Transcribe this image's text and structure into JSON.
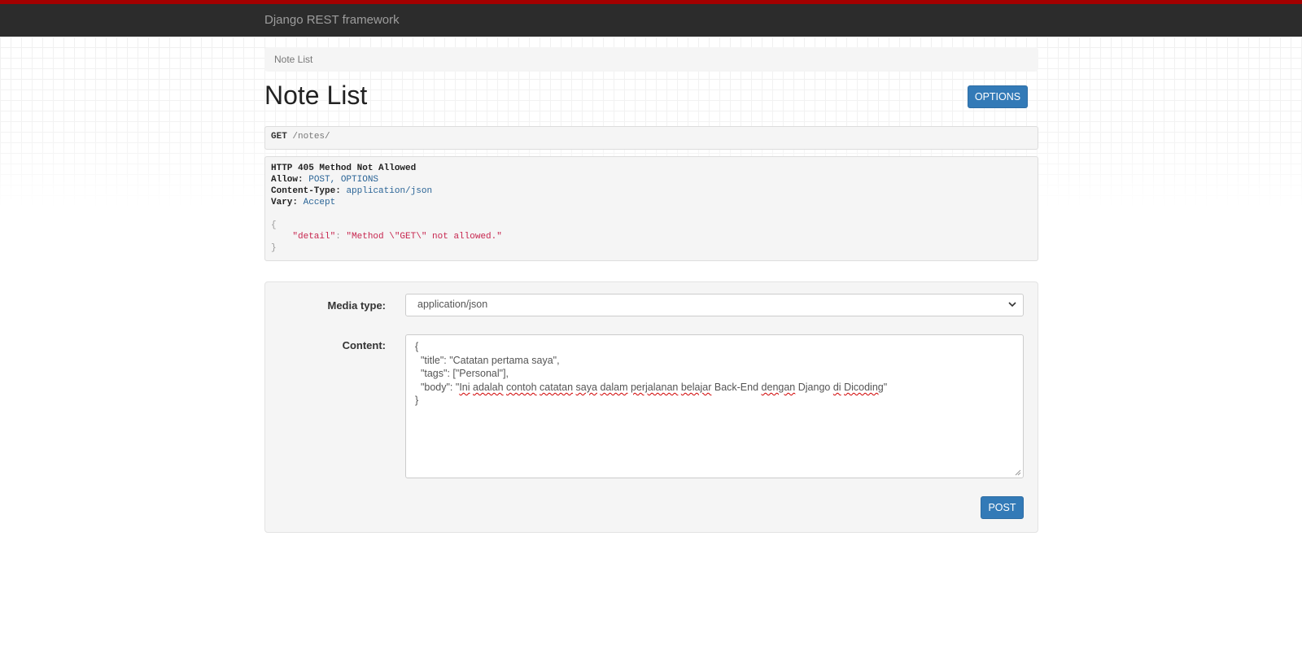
{
  "navbar": {
    "brand": "Django REST framework"
  },
  "breadcrumb": {
    "items": [
      "Note List"
    ]
  },
  "page": {
    "title": "Note List",
    "options_label": "OPTIONS"
  },
  "request": {
    "method": "GET",
    "path": "/notes/"
  },
  "response": {
    "status": "HTTP 405 Method Not Allowed",
    "headers": [
      {
        "name": "Allow:",
        "value": "POST, OPTIONS"
      },
      {
        "name": "Content-Type:",
        "value": "application/json"
      },
      {
        "name": "Vary:",
        "value": "Accept"
      }
    ],
    "body": {
      "open": "{",
      "key": "\"detail\"",
      "sep": ": ",
      "value": "\"Method \\\"GET\\\" not allowed.\"",
      "close": "}"
    }
  },
  "form": {
    "media_type_label": "Media type:",
    "media_type_value": "application/json",
    "content_label": "Content:",
    "content_lines": {
      "l1": "{",
      "l2": "  \"title\": \"Catatan pertama saya\",",
      "l3": "  \"tags\": [\"Personal\"],",
      "l4_pre": "  \"body\": \"",
      "w_ini": "Ini",
      "w_adalah": "adalah",
      "w_contoh": "contoh",
      "w_catatan": "catatan",
      "w_saya": "saya",
      "w_dalam": "dalam",
      "w_perjalanan": "perjalanan",
      "w_belajar": "belajar",
      "w_backend": "Back-End",
      "w_dengan": "dengan",
      "w_django": "Django",
      "w_di": "di",
      "w_dicoding": "Dicoding",
      "l4_post": "\"",
      "l5": "}"
    },
    "post_label": "POST"
  },
  "colors": {
    "navbar_bg": "#2c2c2c",
    "navbar_accent": "#a30000",
    "button_primary": "#337ab7",
    "json_string": "#c7254e",
    "header_value": "#2a6496"
  }
}
